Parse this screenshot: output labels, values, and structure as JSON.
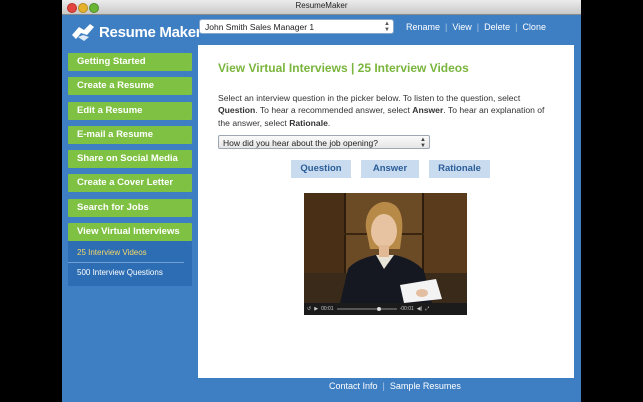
{
  "window": {
    "title": "ResumeMaker"
  },
  "logo": {
    "text": "Resume Maker"
  },
  "toolbar": {
    "resume_select": "John Smith Sales Manager 1",
    "links": [
      "Rename",
      "View",
      "Delete",
      "Clone"
    ]
  },
  "sidebar": {
    "items": [
      {
        "label": "Getting Started"
      },
      {
        "label": "Create a Resume"
      },
      {
        "label": "Edit a Resume"
      },
      {
        "label": "E-mail a Resume"
      },
      {
        "label": "Share on Social Media"
      },
      {
        "label": "Create a Cover Letter"
      },
      {
        "label": "Search for Jobs"
      },
      {
        "label": "View Virtual Interviews"
      }
    ],
    "subitems": [
      {
        "label": "25 Interview Videos"
      },
      {
        "label": "500 Interview Questions"
      }
    ]
  },
  "main": {
    "title": "View Virtual Interviews | 25 Interview Videos",
    "intro": {
      "p1": "Select an interview question in the picker below. To listen to the question, select ",
      "b1": "Question",
      "p2": ". To hear a recommended answer, select ",
      "b2": "Answer",
      "p3": ". To hear an explanation of the answer, select ",
      "b3": "Rationale",
      "p4": "."
    },
    "question_picker": "How did you hear about the job opening?",
    "buttons": {
      "question": "Question",
      "answer": "Answer",
      "rationale": "Rationale"
    },
    "video": {
      "elapsed": "00:01",
      "remaining": "-00:01"
    }
  },
  "footer": {
    "links": [
      "Contact Info",
      "Sample Resumes"
    ]
  },
  "colors": {
    "brand_blue": "#3e7fc4",
    "nav_green": "#7fc243",
    "title_green": "#7ab53d",
    "button_blue": "#c9dbef"
  }
}
